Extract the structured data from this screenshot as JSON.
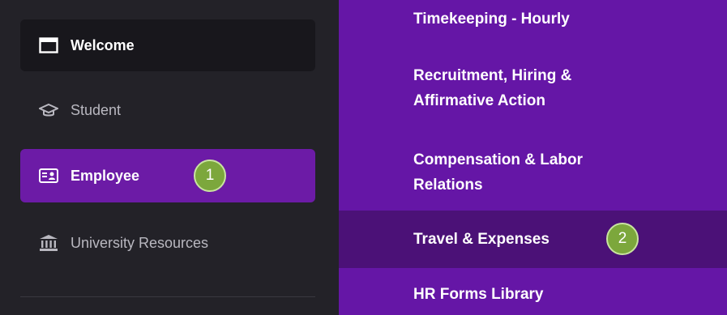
{
  "sidebar": {
    "items": [
      {
        "label": "Welcome",
        "icon": "window-icon",
        "state": "default"
      },
      {
        "label": "Student",
        "icon": "graduation-cap-icon",
        "state": "default"
      },
      {
        "label": "Employee",
        "icon": "id-card-icon",
        "state": "active"
      },
      {
        "label": "University Resources",
        "icon": "university-building-icon",
        "state": "default"
      }
    ]
  },
  "submenu": {
    "items": [
      {
        "label": "Timekeeping - Hourly"
      },
      {
        "label": "Recruitment, Hiring & Affirmative Action"
      },
      {
        "label": "Compensation & Labor Relations"
      },
      {
        "label": "Travel & Expenses",
        "state": "hover"
      },
      {
        "label": "HR Forms Library"
      }
    ]
  },
  "annotations": {
    "step1": "1",
    "step2": "2"
  },
  "colors": {
    "sidebar_bg": "#232228",
    "active_item": "#6c1ba6",
    "submenu_bg": "#6516a6",
    "submenu_hover": "#4b1177",
    "badge": "#7ca73c"
  }
}
